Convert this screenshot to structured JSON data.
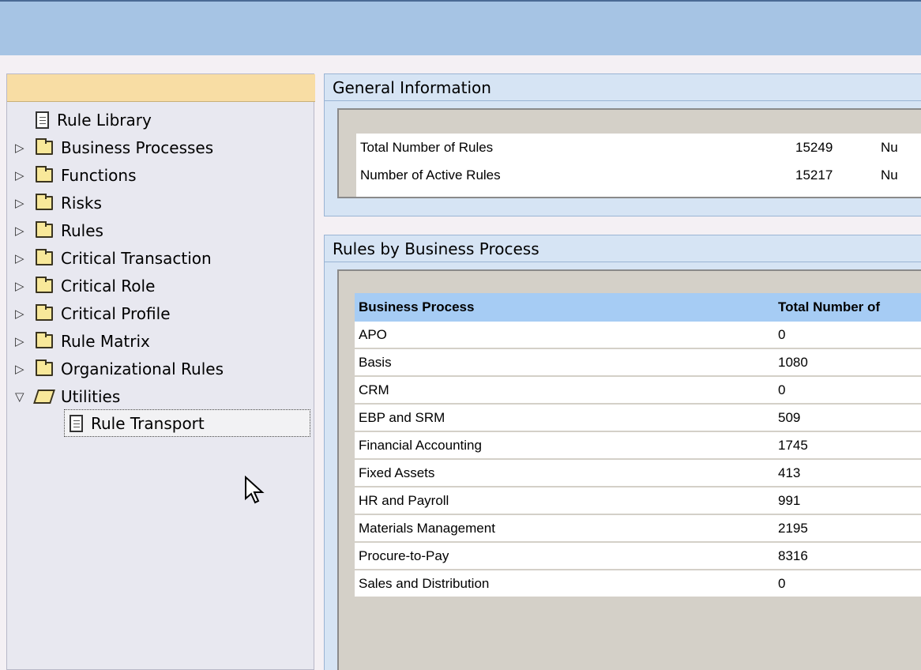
{
  "tree": {
    "items": [
      {
        "label": "Rule Library",
        "type": "doc",
        "arrow": ""
      },
      {
        "label": "Business Processes",
        "type": "folder",
        "arrow": "▷"
      },
      {
        "label": "Functions",
        "type": "folder",
        "arrow": "▷"
      },
      {
        "label": "Risks",
        "type": "folder",
        "arrow": "▷"
      },
      {
        "label": "Rules",
        "type": "folder",
        "arrow": "▷"
      },
      {
        "label": "Critical Transaction",
        "type": "folder",
        "arrow": "▷"
      },
      {
        "label": "Critical Role",
        "type": "folder",
        "arrow": "▷"
      },
      {
        "label": "Critical Profile",
        "type": "folder",
        "arrow": "▷"
      },
      {
        "label": "Rule Matrix",
        "type": "folder",
        "arrow": "▷"
      },
      {
        "label": "Organizational Rules",
        "type": "folder",
        "arrow": "▷"
      },
      {
        "label": "Utilities",
        "type": "open-folder",
        "arrow": "▽"
      }
    ],
    "child": {
      "label": "Rule Transport",
      "type": "doc"
    }
  },
  "general": {
    "tab": "General Information",
    "rows": [
      {
        "label": "Total Number of Rules",
        "value": "15249",
        "extra": "Nu"
      },
      {
        "label": "Number of Active Rules",
        "value": "15217",
        "extra": "Nu"
      }
    ]
  },
  "by_process": {
    "tab": "Rules by Business Process",
    "header": {
      "name": "Business Process",
      "value": "Total Number of"
    },
    "rows": [
      {
        "name": "APO",
        "value": "0"
      },
      {
        "name": "Basis",
        "value": "1080"
      },
      {
        "name": "CRM",
        "value": "0"
      },
      {
        "name": "EBP and SRM",
        "value": "509"
      },
      {
        "name": "Financial Accounting",
        "value": "1745"
      },
      {
        "name": "Fixed Assets",
        "value": "413"
      },
      {
        "name": "HR and Payroll",
        "value": "991"
      },
      {
        "name": "Materials Management",
        "value": "2195"
      },
      {
        "name": "Procure-to-Pay",
        "value": "8316"
      },
      {
        "name": "Sales and Distribution",
        "value": "0"
      }
    ]
  },
  "colors": {
    "topbar": "#a6c4e4",
    "tree_header": "#f8dda4",
    "panel": "#d6e4f4",
    "table_header": "#a6ccf4"
  }
}
